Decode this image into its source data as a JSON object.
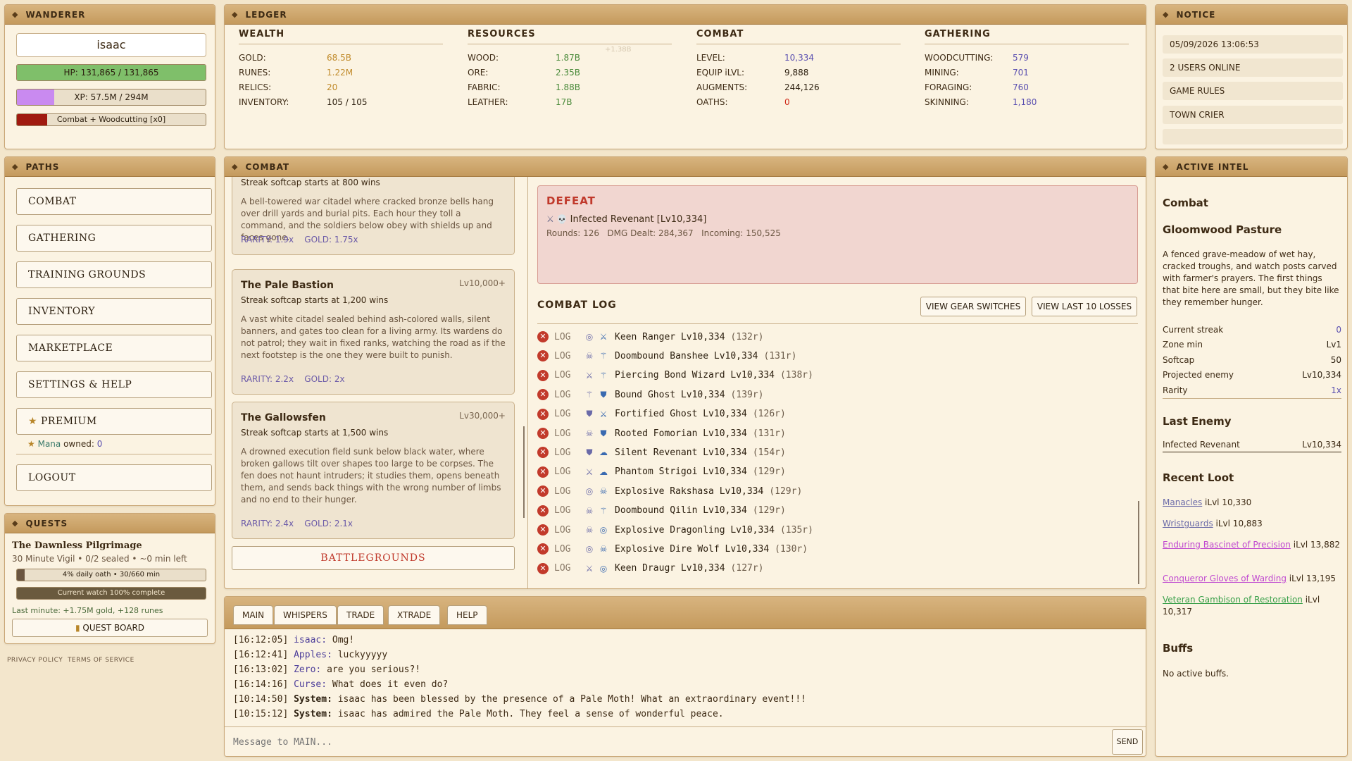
{
  "wanderer": {
    "title": "WANDERER",
    "name": "isaac",
    "hp": {
      "label": "HP: 131,865 / 131,865",
      "fraction": 1.0
    },
    "xp": {
      "label": "XP: 57.5M / 294M",
      "fraction": 0.196
    },
    "action": {
      "label": "Combat + Woodcutting [x0]",
      "fraction": 0.16
    },
    "colors": {
      "hp": "#7fbf6a",
      "xp": "#c98af0",
      "action": "#a01a10"
    }
  },
  "ledger": {
    "title": "LEDGER",
    "faint_text": "+1.38B",
    "columns": [
      {
        "title": "WEALTH",
        "rows": [
          {
            "k": "GOLD:",
            "v": "68.5B",
            "color": "#c08a2a"
          },
          {
            "k": "RUNES:",
            "v": "1.22M",
            "color": "#c08a2a"
          },
          {
            "k": "RELICS:",
            "v": "20",
            "color": "#c08a2a"
          },
          {
            "k": "INVENTORY:",
            "v": "105 / 105",
            "color": "#2d2010"
          }
        ]
      },
      {
        "title": "RESOURCES",
        "rows": [
          {
            "k": "WOOD:",
            "v": "1.87B",
            "color": "#4a8a3a"
          },
          {
            "k": "ORE:",
            "v": "2.35B",
            "color": "#4a8a3a"
          },
          {
            "k": "FABRIC:",
            "v": "1.88B",
            "color": "#4a8a3a"
          },
          {
            "k": "LEATHER:",
            "v": "17B",
            "color": "#4a8a3a"
          }
        ]
      },
      {
        "title": "COMBAT",
        "rows": [
          {
            "k": "LEVEL:",
            "v": "10,334",
            "color": "#5a4fb0"
          },
          {
            "k": "EQUIP iLVL:",
            "v": "9,888",
            "color": "#2d2010"
          },
          {
            "k": "AUGMENTS:",
            "v": "244,126",
            "color": "#2d2010"
          },
          {
            "k": "OATHS:",
            "v": "0",
            "color": "#d02a1a"
          }
        ]
      },
      {
        "title": "GATHERING",
        "rows": [
          {
            "k": "WOODCUTTING:",
            "v": "579",
            "color": "#5a4fb0"
          },
          {
            "k": "MINING:",
            "v": "701",
            "color": "#5a4fb0"
          },
          {
            "k": "FORAGING:",
            "v": "760",
            "color": "#5a4fb0"
          },
          {
            "k": "SKINNING:",
            "v": "1,180",
            "color": "#5a4fb0"
          }
        ]
      }
    ]
  },
  "notice": {
    "title": "NOTICE",
    "items": [
      "05/09/2026 13:06:53",
      "2 USERS ONLINE",
      "GAME RULES",
      "TOWN CRIER"
    ]
  },
  "paths": {
    "title": "PATHS",
    "items": [
      "COMBAT",
      "GATHERING",
      "TRAINING GROUNDS",
      "INVENTORY",
      "MARKETPLACE",
      "SETTINGS & HELP",
      "PREMIUM",
      "LOGOUT"
    ],
    "premium_star": "★",
    "mana": {
      "star": "★",
      "label": "Mana",
      "text": "owned:",
      "value": "0"
    }
  },
  "quests": {
    "title": "QUESTS",
    "name": "The Dawnless Pilgrimage",
    "sub": "30 Minute Vigil • 0/2 sealed • ~0 min left",
    "bar1": {
      "label": "4% daily oath • 30/660 min",
      "fraction": 0.04
    },
    "bar2": {
      "label": "Current watch 100% complete",
      "fraction": 1.0
    },
    "last_minute": "Last minute: +1.75M gold, +128 runes",
    "board_label": "QUEST BOARD"
  },
  "footer": {
    "privacy": "PRIVACY POLICY",
    "terms": "TERMS OF SERVICE"
  },
  "combat": {
    "title": "COMBAT",
    "zones": [
      {
        "title": "",
        "level": "",
        "softcap": "Streak softcap starts at 800 wins",
        "desc": "A bell-towered war citadel where cracked bronze bells hang over drill yards and burial pits. Each hour they toll a command, and the soldiers below obey with shields up and faces gone.",
        "rarity": "RARITY: 1.9x    GOLD: 1.75x"
      },
      {
        "title": "The Pale Bastion",
        "level": "Lv10,000+",
        "softcap": "Streak softcap starts at 1,200 wins",
        "desc": "A vast white citadel sealed behind ash-colored walls, silent banners, and gates too clean for a living army. Its wardens do not patrol; they wait in fixed ranks, watching the road as if the next footstep is the one they were built to punish.",
        "rarity": "RARITY: 2.2x    GOLD: 2x"
      },
      {
        "title": "The Gallowsfen",
        "level": "Lv30,000+",
        "softcap": "Streak softcap starts at 1,500 wins",
        "desc": "A drowned execution field sunk below black water, where broken gallows tilt over shapes too large to be corpses. The fen does not haunt intruders; it studies them, opens beneath them, and sends back things with the wrong number of limbs and no end to their hunger.",
        "rarity": "RARITY: 2.4x    GOLD: 2.1x"
      }
    ],
    "battlegrounds": "BATTLEGROUNDS",
    "defeat": {
      "title": "DEFEAT",
      "enemy": "Infected Revenant [Lv10,334]",
      "icons": "⚔ 💀",
      "stats": "Rounds: 126   DMG Dealt: 284,367   Incoming: 150,525"
    },
    "log_title": "COMBAT LOG",
    "btn_gear": "VIEW GEAR SWITCHES",
    "btn_losses": "VIEW LAST 10 LOSSES",
    "log": [
      {
        "tag": "LOG",
        "i1": "◎",
        "i2": "⚔",
        "name": "Keen Ranger Lv10,334",
        "rounds": "(132r)"
      },
      {
        "tag": "LOG",
        "i1": "☠",
        "i2": "⚚",
        "name": "Doombound Banshee Lv10,334",
        "rounds": "(131r)"
      },
      {
        "tag": "LOG",
        "i1": "⚔",
        "i2": "⚚",
        "name": "Piercing Bond Wizard Lv10,334",
        "rounds": "(138r)"
      },
      {
        "tag": "LOG",
        "i1": "⚚",
        "i2": "⛊",
        "name": "Bound Ghost Lv10,334",
        "rounds": "(139r)"
      },
      {
        "tag": "LOG",
        "i1": "⛊",
        "i2": "⚔",
        "name": "Fortified Ghost Lv10,334",
        "rounds": "(126r)"
      },
      {
        "tag": "LOG",
        "i1": "☠",
        "i2": "⛊",
        "name": "Rooted Fomorian Lv10,334",
        "rounds": "(131r)"
      },
      {
        "tag": "LOG",
        "i1": "⛊",
        "i2": "☁",
        "name": "Silent Revenant Lv10,334",
        "rounds": "(154r)"
      },
      {
        "tag": "LOG",
        "i1": "⚔",
        "i2": "☁",
        "name": "Phantom Strigoi Lv10,334",
        "rounds": "(129r)"
      },
      {
        "tag": "LOG",
        "i1": "◎",
        "i2": "☠",
        "name": "Explosive Rakshasa Lv10,334",
        "rounds": "(129r)"
      },
      {
        "tag": "LOG",
        "i1": "☠",
        "i2": "⚚",
        "name": "Doombound Qilin Lv10,334",
        "rounds": "(129r)"
      },
      {
        "tag": "LOG",
        "i1": "☠",
        "i2": "◎",
        "name": "Explosive Dragonling Lv10,334",
        "rounds": "(135r)"
      },
      {
        "tag": "LOG",
        "i1": "◎",
        "i2": "☠",
        "name": "Explosive Dire Wolf Lv10,334",
        "rounds": "(130r)"
      },
      {
        "tag": "LOG",
        "i1": "⚔",
        "i2": "◎",
        "name": "Keen Draugr Lv10,334",
        "rounds": "(127r)"
      }
    ],
    "log_x": "✕"
  },
  "chat": {
    "tabs": [
      "MAIN",
      "WHISPERS",
      "TRADE",
      "XTRADE",
      "HELP"
    ],
    "lines": [
      {
        "ts": "[16:12:05]",
        "who": "isaac:",
        "msg": " Omg!",
        "sys": false
      },
      {
        "ts": "[16:12:41]",
        "who": "Apples:",
        "msg": " luckyyyyy",
        "sys": false
      },
      {
        "ts": "[16:13:02]",
        "who": "Zero:",
        "msg": " are you serious?!",
        "sys": false
      },
      {
        "ts": "[16:14:16]",
        "who": "Curse:",
        "msg": " What does it even do?",
        "sys": false
      },
      {
        "ts": "[10:14:50]",
        "who": "System:",
        "msg": " isaac has been blessed by the presence of a Pale Moth! What an extraordinary event!!!",
        "sys": true
      },
      {
        "ts": "[10:15:12]",
        "who": "System:",
        "msg": " isaac has admired the Pale Moth. They feel a sense of wonderful peace.",
        "sys": true
      }
    ],
    "placeholder": "Message to MAIN...",
    "send": "SEND"
  },
  "intel": {
    "title": "ACTIVE INTEL",
    "section": "Combat",
    "zone": "Gloomwood Pasture",
    "desc": "A fenced grave-meadow of wet hay, cracked troughs, and watch posts carved with farmer's prayers. The first things that bite here are small, but they bite like they remember hunger.",
    "stats": [
      {
        "k": "Current streak",
        "v": "0",
        "color": "#5a4fb0"
      },
      {
        "k": "Zone min",
        "v": "Lv1",
        "color": "#2d2010"
      },
      {
        "k": "Softcap",
        "v": "50",
        "color": "#2d2010"
      },
      {
        "k": "Projected enemy",
        "v": "Lv10,334",
        "color": "#2d2010"
      },
      {
        "k": "Rarity",
        "v": "1x",
        "color": "#5a4fb0"
      }
    ],
    "last_enemy_title": "Last Enemy",
    "last_enemy": {
      "k": "Infected Revenant",
      "v": "Lv10,334"
    },
    "loot_title": "Recent Loot",
    "loot": [
      {
        "name": "Manacles",
        "ilvl": " iLvl 10,330",
        "color": "#6a6aa8"
      },
      {
        "name": "Wristguards",
        "ilvl": " iLvl 10,883",
        "color": "#6a6aa8"
      },
      {
        "name": "Enduring Bascinet of Precision",
        "ilvl": " iLvl 13,882",
        "color": "#c04ad0"
      },
      {
        "name": "Conqueror Gloves of Warding",
        "ilvl": " iLvl 13,195",
        "color": "#c04ad0"
      },
      {
        "name": "Veteran Gambison of Restoration",
        "ilvl": " iLvl 10,317",
        "color": "#3aa04a"
      }
    ],
    "buffs_title": "Buffs",
    "buffs": "No active buffs."
  }
}
